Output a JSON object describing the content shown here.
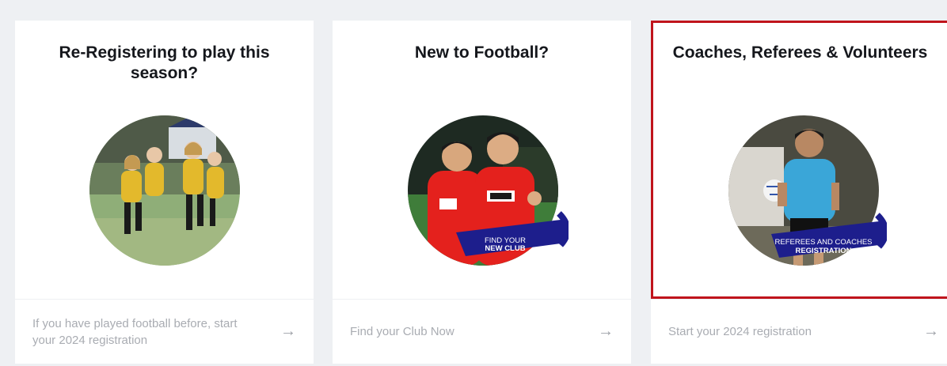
{
  "cards": [
    {
      "title": "Re-Registering to play this season?",
      "image": "girls-team-celebrating-photo",
      "footer": "If you have played football before, start your 2024 registration",
      "arrow": "→"
    },
    {
      "title": "New to Football?",
      "image": "players-celebrating-photo",
      "badge": {
        "line1": "FIND YOUR",
        "line2": "NEW CLUB"
      },
      "footer": "Find your Club Now",
      "arrow": "→"
    },
    {
      "title": "Coaches, Referees & Volunteers",
      "image": "referee-photo",
      "badge": {
        "line1": "REFEREES AND COACHES",
        "line2": "REGISTRATION"
      },
      "footer": "Start your 2024 registration",
      "arrow": "→"
    }
  ],
  "colors": {
    "page_bg": "#eef0f3",
    "highlight_border": "#c0141c",
    "badge_navy": "#1d1e8c",
    "footer_text": "#a9acb2"
  }
}
